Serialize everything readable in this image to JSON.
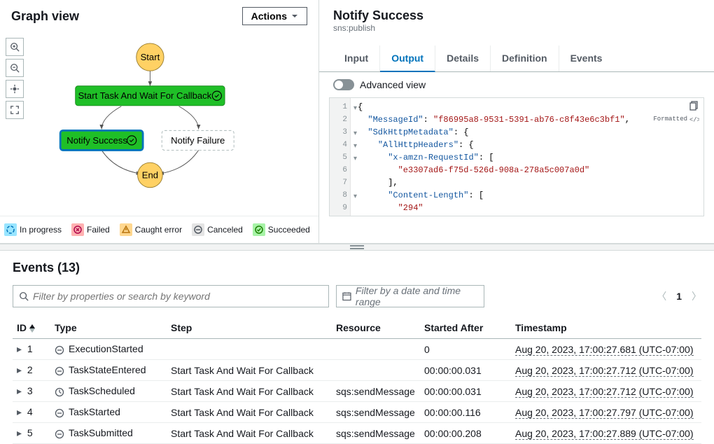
{
  "graph": {
    "title": "Graph view",
    "actions_label": "Actions",
    "nodes": {
      "start": "Start",
      "end": "End",
      "task": "Start Task And Wait For Callback",
      "success": "Notify Success",
      "failure": "Notify Failure"
    },
    "legend": {
      "in_progress": "In progress",
      "failed": "Failed",
      "caught_error": "Caught error",
      "canceled": "Canceled",
      "succeeded": "Succeeded"
    }
  },
  "detail": {
    "title": "Notify Success",
    "subtitle": "sns:publish",
    "tabs": {
      "input": "Input",
      "output": "Output",
      "details": "Details",
      "definition": "Definition",
      "events": "Events"
    },
    "advanced": "Advanced view",
    "formatted": "Formatted",
    "json": {
      "l1": "{",
      "l2a": "\"MessageId\"",
      "l2b": ": ",
      "l2c": "\"f86995a8-9531-5391-ab76-c8f43e6c3bf1\"",
      "l2d": ",",
      "l3a": "\"SdkHttpMetadata\"",
      "l3b": ": {",
      "l4a": "\"AllHttpHeaders\"",
      "l4b": ": {",
      "l5a": "\"x-amzn-RequestId\"",
      "l5b": ": [",
      "l6": "\"e3307ad6-f75d-526d-908a-278a5c007a0d\"",
      "l7": "],",
      "l8a": "\"Content-Length\"",
      "l8b": ": [",
      "l9": "\"294\"",
      "l10": "]"
    }
  },
  "events": {
    "title": "Events (13)",
    "filter_placeholder": "Filter by properties or search by keyword",
    "date_placeholder": "Filter by a date and time range",
    "page": "1",
    "columns": {
      "id": "ID",
      "type": "Type",
      "step": "Step",
      "resource": "Resource",
      "started": "Started After",
      "timestamp": "Timestamp"
    },
    "rows": [
      {
        "id": "1",
        "type": "ExecutionStarted",
        "icon": "dash",
        "step": "",
        "resource": "",
        "started": "0",
        "ts": "Aug 20, 2023, 17:00:27.681 (UTC-07:00)"
      },
      {
        "id": "2",
        "type": "TaskStateEntered",
        "icon": "dash",
        "step": "Start Task And Wait For Callback",
        "resource": "",
        "started": "00:00:00.031",
        "ts": "Aug 20, 2023, 17:00:27.712 (UTC-07:00)"
      },
      {
        "id": "3",
        "type": "TaskScheduled",
        "icon": "clock",
        "step": "Start Task And Wait For Callback",
        "resource": "sqs:sendMessage",
        "started": "00:00:00.031",
        "ts": "Aug 20, 2023, 17:00:27.712 (UTC-07:00)"
      },
      {
        "id": "4",
        "type": "TaskStarted",
        "icon": "dash",
        "step": "Start Task And Wait For Callback",
        "resource": "sqs:sendMessage",
        "started": "00:00:00.116",
        "ts": "Aug 20, 2023, 17:00:27.797 (UTC-07:00)"
      },
      {
        "id": "5",
        "type": "TaskSubmitted",
        "icon": "dash",
        "step": "Start Task And Wait For Callback",
        "resource": "sqs:sendMessage",
        "started": "00:00:00.208",
        "ts": "Aug 20, 2023, 17:00:27.889 (UTC-07:00)"
      }
    ]
  }
}
